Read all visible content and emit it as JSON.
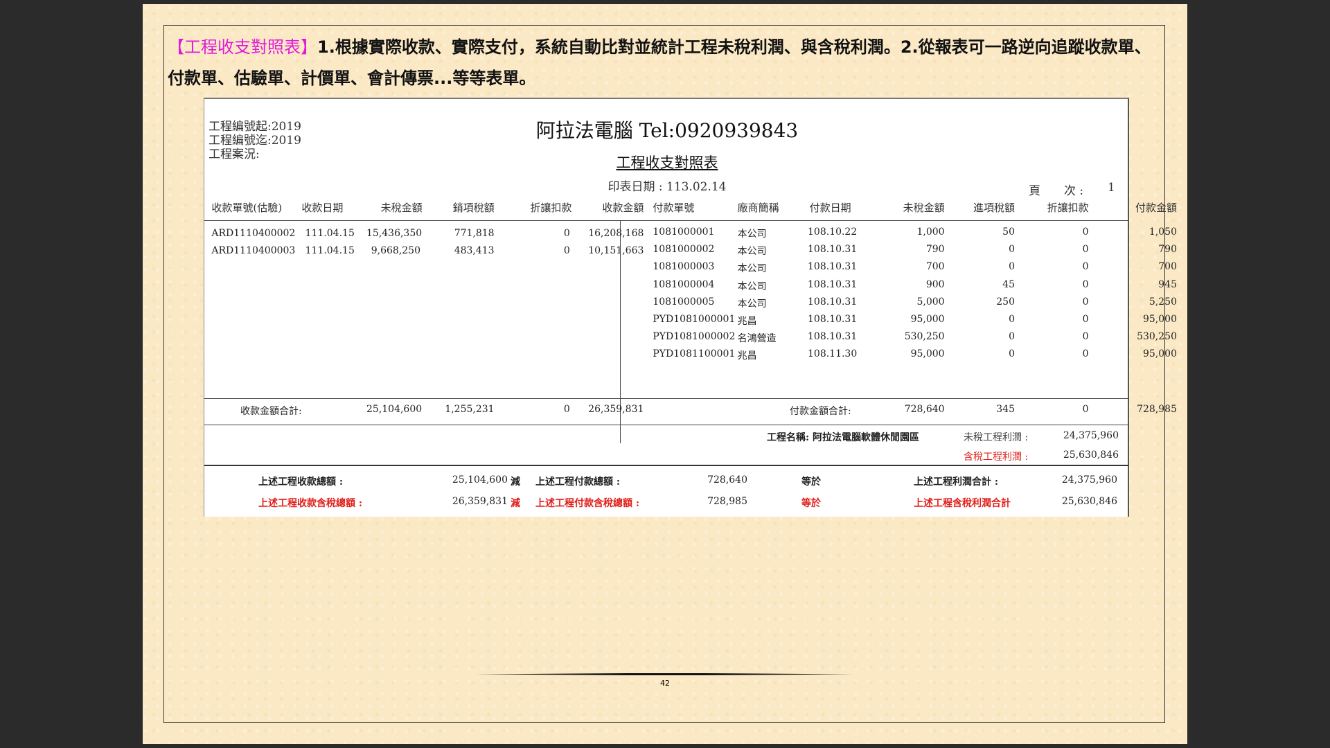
{
  "intro": {
    "highlight": "【工程收支對照表】",
    "text": "1.根據實際收款、實際支付，系統自動比對並統計工程未稅利潤、與含稅利潤。2.從報表可一路逆向追蹤收款單、付款單、估驗單、計價單、會計傳票...等等表單。"
  },
  "report": {
    "filter_from": "工程編號起:2019",
    "filter_to": "工程編號迄:2019",
    "filter_status": "工程案況:",
    "company": "阿拉法電腦 Tel:0920939843",
    "title": "工程收支對照表",
    "print_date": "印表日期 : 113.02.14",
    "page_label": "頁　　次 :",
    "page_number": "1"
  },
  "receipts": {
    "headers": [
      "收款單號(估驗)",
      "收款日期",
      "未稅金額",
      "銷項稅額",
      "折讓扣款",
      "收款金額"
    ],
    "rows": [
      [
        "ARD1110400002",
        "111.04.15",
        "15,436,350",
        "771,818",
        "0",
        "16,208,168"
      ],
      [
        "ARD1110400003",
        "111.04.15",
        "9,668,250",
        "483,413",
        "0",
        "10,151,663"
      ]
    ],
    "total_label": "收款金額合計:",
    "totals": [
      "25,104,600",
      "1,255,231",
      "0",
      "26,359,831"
    ]
  },
  "payments": {
    "headers": [
      "付款單號",
      "廠商簡稱",
      "付款日期",
      "未稅金額",
      "進項稅額",
      "折讓扣款",
      "付款金額"
    ],
    "rows": [
      [
        "1081000001",
        "本公司",
        "108.10.22",
        "1,000",
        "50",
        "0",
        "1,050"
      ],
      [
        "1081000002",
        "本公司",
        "108.10.31",
        "790",
        "0",
        "0",
        "790"
      ],
      [
        "1081000003",
        "本公司",
        "108.10.31",
        "700",
        "0",
        "0",
        "700"
      ],
      [
        "1081000004",
        "本公司",
        "108.10.31",
        "900",
        "45",
        "0",
        "945"
      ],
      [
        "1081000005",
        "本公司",
        "108.10.31",
        "5,000",
        "250",
        "0",
        "5,250"
      ],
      [
        "PYD1081000001",
        "兆昌",
        "108.10.31",
        "95,000",
        "0",
        "0",
        "95,000"
      ],
      [
        "PYD1081000002",
        "名鴻營造",
        "108.10.31",
        "530,250",
        "0",
        "0",
        "530,250"
      ],
      [
        "PYD1081100001",
        "兆昌",
        "108.11.30",
        "95,000",
        "0",
        "0",
        "95,000"
      ]
    ],
    "total_label": "付款金額合計:",
    "totals": [
      "728,640",
      "345",
      "0",
      "728,985"
    ]
  },
  "project": {
    "name": "工程名稱: 阿拉法電腦軟體休閒園區",
    "pretax_label": "未稅工程利潤 :",
    "pretax_value": "24,375,960",
    "taxed_label": "含稅工程利潤 :",
    "taxed_value": "25,630,846"
  },
  "summary": {
    "line1": {
      "recv_label": "上述工程收款總額 :",
      "recv_value": "25,104,600",
      "minus": "減",
      "pay_label": "上述工程付款總額 :",
      "pay_value": "728,640",
      "equals": "等於",
      "profit_label": "上述工程利潤合計 :",
      "profit_value": "24,375,960"
    },
    "line2": {
      "recv_label": "上述工程收款含稅總額 :",
      "recv_value": "26,359,831",
      "minus": "減",
      "pay_label": "上述工程付款含稅總額 :",
      "pay_value": "728,985",
      "equals": "等於",
      "profit_label": "上述工程含稅利潤合計",
      "profit_value": "25,630,846"
    }
  },
  "page_number": "42",
  "colors": {
    "highlight": "#e11ad8",
    "red": "#e0201a",
    "paper": "#fbe9c6"
  }
}
